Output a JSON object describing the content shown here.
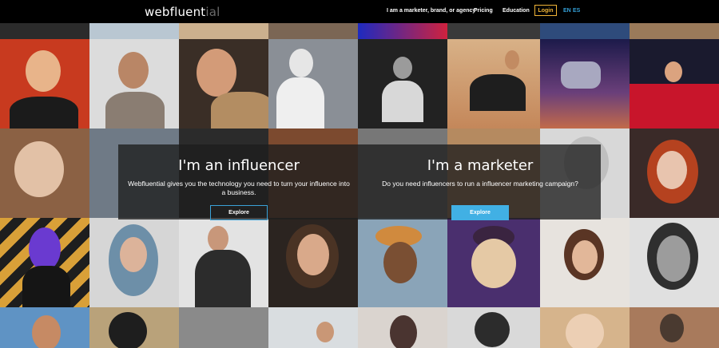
{
  "header": {
    "logo_main": "webfluent",
    "logo_dim": "ial",
    "nav_links": [
      "I am a marketer, brand, or agency",
      "Pricing",
      "Education"
    ],
    "login_label": "Login",
    "languages": [
      "EN",
      "ES"
    ]
  },
  "panels": {
    "influencer": {
      "title": "I'm an influencer",
      "text": "Webfluential gives you the technology you need to turn your influence into a business.",
      "button": "Explore"
    },
    "marketer": {
      "title": "I'm a marketer",
      "text": "Do you need influencers to run a influencer marketing campaign?",
      "button": "Explore"
    }
  },
  "colors": {
    "login_border": "#f0b437",
    "language_link": "#34a1d9",
    "explore_button": "#41b0e4"
  }
}
